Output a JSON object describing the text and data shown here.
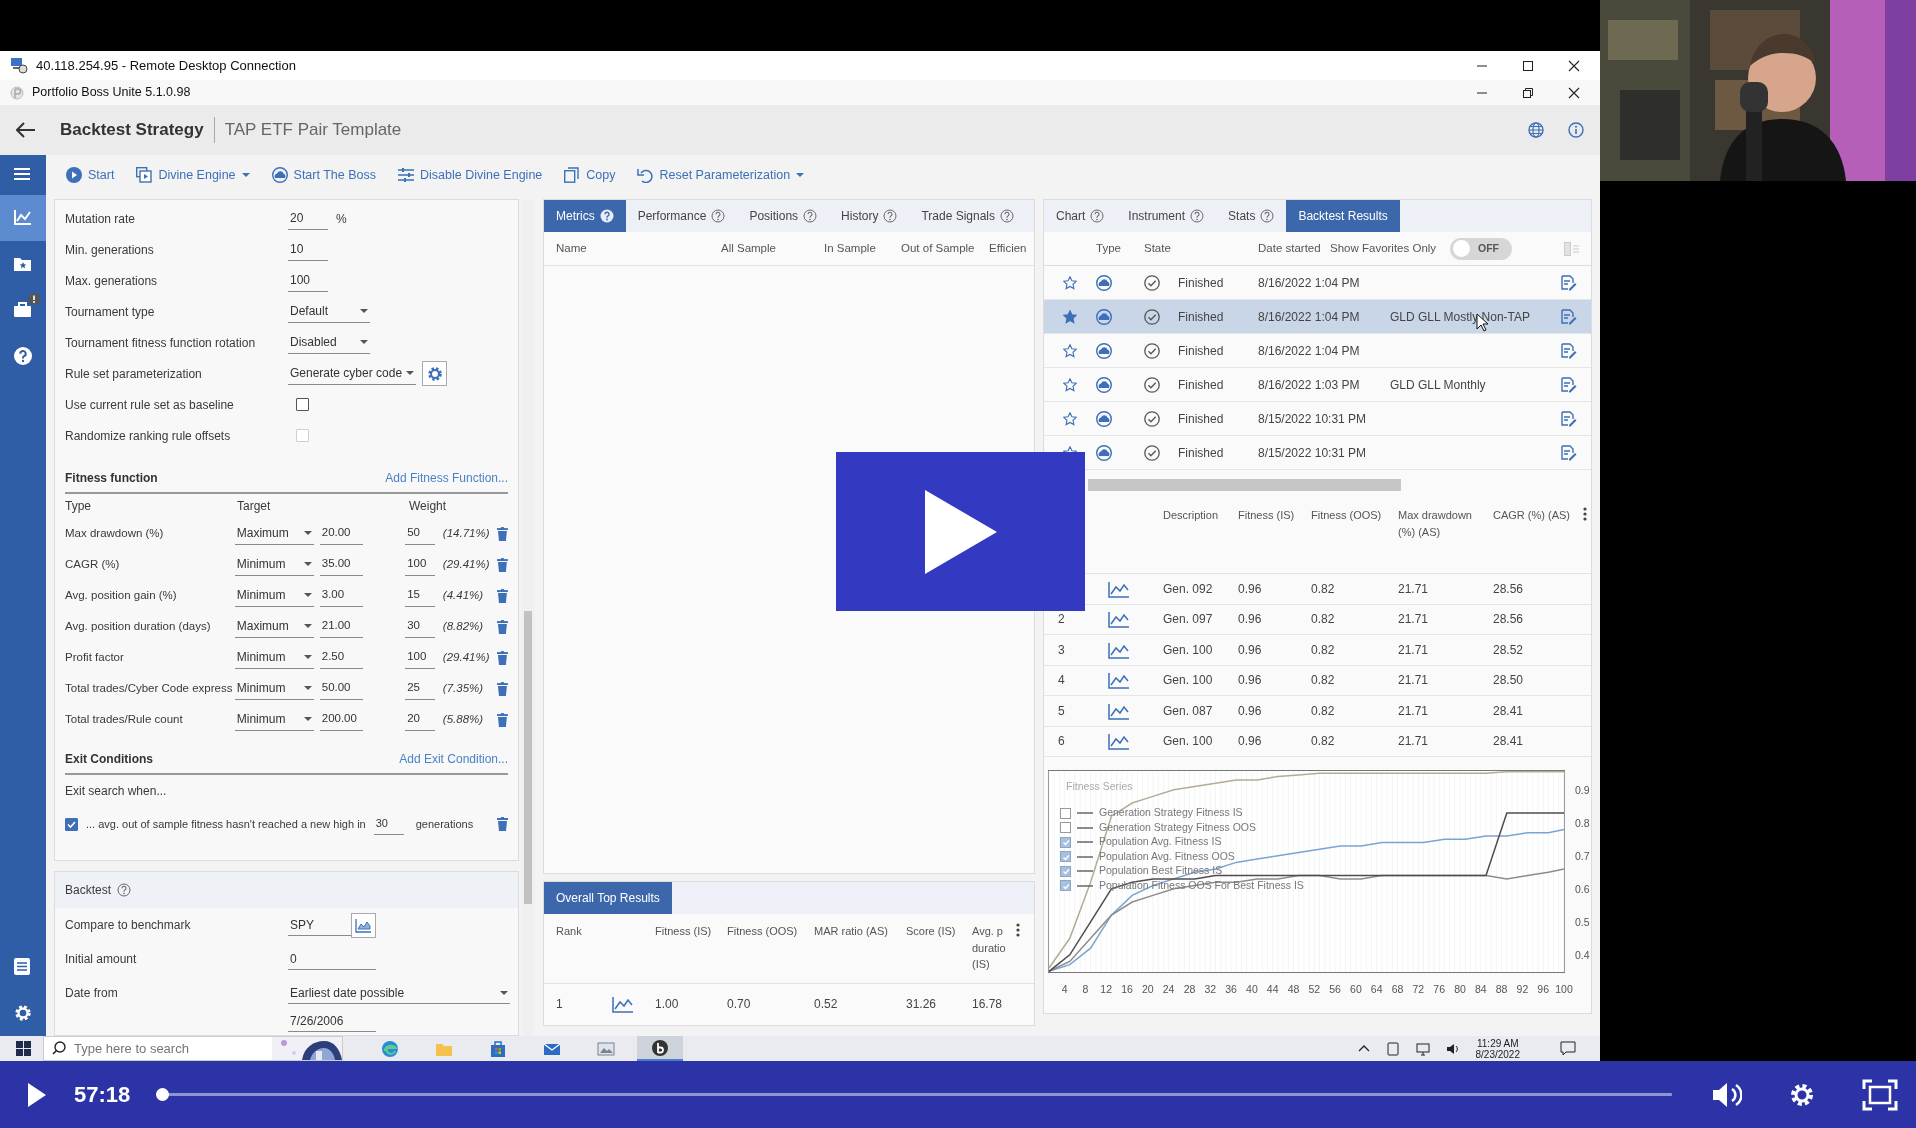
{
  "video": {
    "paused": true,
    "time": "57:18",
    "level": 0
  },
  "rdp_window": {
    "title": "40.118.254.95 - Remote Desktop Connection"
  },
  "app_window": {
    "title": "Portfolio Boss Unite 5.1.0.98"
  },
  "header": {
    "title": "Backtest Strategy",
    "subtitle": "TAP ETF Pair Template"
  },
  "sidebar": {
    "top": [
      {
        "kind": "menu",
        "selected": false,
        "alert": false
      },
      {
        "kind": "strategy",
        "selected": true,
        "alert": false
      },
      {
        "kind": "library",
        "selected": false,
        "alert": false
      },
      {
        "kind": "portfolio",
        "selected": false,
        "alert": true
      },
      {
        "kind": "help",
        "selected": false,
        "alert": false
      }
    ],
    "bottom": [
      {
        "kind": "log",
        "selected": false,
        "alert": false
      },
      {
        "kind": "settings",
        "selected": false,
        "alert": false
      }
    ]
  },
  "toolbar": [
    {
      "kind": "start",
      "label": "Start",
      "dropdown": false
    },
    {
      "kind": "engine",
      "label": "Divine Engine",
      "dropdown": true
    },
    {
      "kind": "boss",
      "label": "Start The Boss",
      "dropdown": false
    },
    {
      "kind": "sliders",
      "label": "Disable Divine Engine",
      "dropdown": false
    },
    {
      "kind": "copy",
      "label": "Copy",
      "dropdown": false
    },
    {
      "kind": "reset",
      "label": "Reset Parameterization",
      "dropdown": true
    }
  ],
  "settings": [
    {
      "kind": "number",
      "label": "Mutation rate",
      "value": "20",
      "unit": "%"
    },
    {
      "kind": "number",
      "label": "Min. generations",
      "value": "10"
    },
    {
      "kind": "number",
      "label": "Max. generations",
      "value": "100"
    },
    {
      "kind": "select",
      "label": "Tournament type",
      "value": "Default"
    },
    {
      "kind": "select",
      "label": "Tournament fitness function rotation",
      "value": "Disabled"
    },
    {
      "kind": "select_config",
      "label": "Rule set parameterization",
      "value": "Generate cyber code"
    },
    {
      "kind": "checkbox",
      "label": "Use current rule set as baseline",
      "checked": false,
      "disabled": false
    },
    {
      "kind": "checkbox",
      "label": "Randomize ranking rule offsets",
      "checked": false,
      "disabled": true
    }
  ],
  "fitness_function": {
    "title": "Fitness function",
    "add_link": "Add Fitness Function...",
    "columns": [
      "Type",
      "Target",
      "Weight"
    ],
    "rows": [
      {
        "type": "Max drawdown (%)",
        "target": "Maximum",
        "value": "20.00",
        "weight": "50",
        "share": "(14.71%)"
      },
      {
        "type": "CAGR (%)",
        "target": "Minimum",
        "value": "35.00",
        "weight": "100",
        "share": "(29.41%)"
      },
      {
        "type": "Avg. position gain (%)",
        "target": "Minimum",
        "value": "3.00",
        "weight": "15",
        "share": "(4.41%)"
      },
      {
        "type": "Avg. position duration (days)",
        "target": "Maximum",
        "value": "21.00",
        "weight": "30",
        "share": "(8.82%)"
      },
      {
        "type": "Profit factor",
        "target": "Minimum",
        "value": "2.50",
        "weight": "100",
        "share": "(29.41%)"
      },
      {
        "type": "Total trades/Cyber Code express",
        "target": "Minimum",
        "value": "50.00",
        "weight": "25",
        "share": "(7.35%)"
      },
      {
        "type": "Total trades/Rule count",
        "target": "Minimum",
        "value": "200.00",
        "weight": "20",
        "share": "(5.88%)"
      }
    ]
  },
  "exit_conditions": {
    "title": "Exit Conditions",
    "add_link": "Add Exit Condition...",
    "intro": "Exit search when...",
    "conditions": [
      {
        "checked": true,
        "text": "... avg. out of sample fitness hasn't reached a new high in",
        "value": "30",
        "unit": "generations"
      }
    ]
  },
  "backtest": {
    "title": "Backtest",
    "fields": [
      {
        "kind": "benchmark",
        "label": "Compare to benchmark",
        "value": "SPY"
      },
      {
        "kind": "number",
        "label": "Initial amount",
        "value": "0"
      },
      {
        "kind": "select",
        "label": "Date from",
        "value": "Earliest date possible"
      },
      {
        "kind": "date",
        "value": "7/26/2006"
      }
    ]
  },
  "metrics_tabs": [
    {
      "label": "Metrics",
      "selected": true,
      "help": true
    },
    {
      "label": "Performance",
      "selected": false,
      "help": true
    },
    {
      "label": "Positions",
      "selected": false,
      "help": true
    },
    {
      "label": "History",
      "selected": false,
      "help": true
    },
    {
      "label": "Trade Signals",
      "selected": false,
      "help": true
    }
  ],
  "metrics_table": {
    "columns": [
      "Name",
      "All Sample",
      "In Sample",
      "Out of Sample",
      "Efficien"
    ]
  },
  "top_results": {
    "title": "Overall Top Results",
    "columns": [
      "Rank",
      "Fitness (IS)",
      "Fitness (OOS)",
      "MAR ratio (AS)",
      "Score (IS)",
      "Avg. p duratio (IS)"
    ],
    "rows": [
      {
        "cells": [
          "1",
          "1.00",
          "0.70",
          "0.52",
          "31.26",
          "16.78"
        ]
      }
    ]
  },
  "result_tabs": [
    {
      "label": "Chart",
      "selected": false,
      "help": true
    },
    {
      "label": "Instrument",
      "selected": false,
      "help": true
    },
    {
      "label": "Stats",
      "selected": false,
      "help": true
    },
    {
      "label": "Backtest Results",
      "selected": true,
      "help": false
    }
  ],
  "backtests": {
    "columns": [
      "Type",
      "State",
      "Date started"
    ],
    "favorites_label": "Show Favorites Only",
    "favorites_toggle": {
      "on": false,
      "label": "OFF"
    },
    "rows": [
      {
        "favorite": false,
        "selected": false,
        "hovered": false,
        "state": "Finished",
        "date": "8/16/2022 1:04 PM"
      },
      {
        "favorite": true,
        "selected": true,
        "hovered": true,
        "state": "Finished",
        "date": "8/16/2022 1:04 PM",
        "description": "GLD GLL Mostly Non-TAP"
      },
      {
        "favorite": false,
        "selected": false,
        "hovered": false,
        "state": "Finished",
        "date": "8/16/2022 1:04 PM"
      },
      {
        "favorite": false,
        "selected": false,
        "hovered": false,
        "state": "Finished",
        "date": "8/16/2022 1:03 PM",
        "description": "GLD GLL Monthly"
      },
      {
        "favorite": false,
        "selected": false,
        "hovered": false,
        "state": "Finished",
        "date": "8/15/2022 10:31 PM"
      },
      {
        "favorite": false,
        "selected": false,
        "hovered": false,
        "state": "Finished",
        "date": "8/15/2022 10:31 PM"
      }
    ]
  },
  "generations": {
    "columns": [
      "Description",
      "Fitness (IS)",
      "Fitness (OOS)",
      "Max drawdown (%) (AS)",
      "CAGR (%) (AS)"
    ],
    "rows": [
      {
        "cells": [
          "Gen. 092",
          "0.96",
          "0.82",
          "21.71",
          "28.56"
        ]
      },
      {
        "rank": "2",
        "cells": [
          "Gen. 097",
          "0.96",
          "0.82",
          "21.71",
          "28.56"
        ]
      },
      {
        "rank": "3",
        "cells": [
          "Gen. 100",
          "0.96",
          "0.82",
          "21.71",
          "28.52"
        ]
      },
      {
        "rank": "4",
        "cells": [
          "Gen. 100",
          "0.96",
          "0.82",
          "21.71",
          "28.50"
        ]
      },
      {
        "rank": "5",
        "cells": [
          "Gen. 087",
          "0.96",
          "0.82",
          "21.71",
          "28.41"
        ]
      },
      {
        "rank": "6",
        "cells": [
          "Gen. 100",
          "0.96",
          "0.82",
          "21.71",
          "28.41"
        ]
      }
    ]
  },
  "fitness_chart": {
    "legend": [
      {
        "label": "Generation Strategy Fitness IS",
        "checked": false
      },
      {
        "label": "Generation Strategy Fitness OOS",
        "checked": false
      },
      {
        "label": "Population Avg. Fitness IS",
        "checked": true
      },
      {
        "label": "Population Avg. Fitness OOS",
        "checked": true
      },
      {
        "label": "Population Best Fitness IS",
        "checked": true
      },
      {
        "label": "Population Fitness OOS For Best Fitness IS",
        "checked": true
      }
    ],
    "chart_data": {
      "type": "line",
      "title": "Fitness Series",
      "x": [
        1,
        5,
        9,
        13,
        17,
        21,
        25,
        29,
        33,
        37,
        41,
        45,
        49,
        53,
        57,
        61,
        65,
        69,
        73,
        77,
        81,
        85,
        89,
        93,
        97,
        100
      ],
      "xlim": [
        1,
        100
      ],
      "ylim": [
        0.345,
        0.96
      ],
      "grid": true,
      "xticks": [
        4,
        8,
        12,
        16,
        20,
        24,
        28,
        32,
        36,
        40,
        44,
        48,
        52,
        56,
        60,
        64,
        68,
        72,
        76,
        80,
        84,
        88,
        92,
        96,
        100
      ],
      "yticks": [
        0.4,
        0.5,
        0.6,
        0.7,
        0.8,
        0.9
      ],
      "series": [
        {
          "color": "#7ba3d3",
          "values": [
            0.35,
            0.37,
            0.42,
            0.52,
            0.58,
            0.61,
            0.63,
            0.65,
            0.66,
            0.68,
            0.69,
            0.7,
            0.71,
            0.72,
            0.73,
            0.73,
            0.74,
            0.74,
            0.74,
            0.75,
            0.75,
            0.76,
            0.76,
            0.77,
            0.77,
            0.78
          ]
        },
        {
          "color": "#8c8c8c",
          "values": [
            0.35,
            0.38,
            0.45,
            0.52,
            0.56,
            0.58,
            0.6,
            0.61,
            0.62,
            0.62,
            0.63,
            0.63,
            0.64,
            0.64,
            0.63,
            0.63,
            0.64,
            0.64,
            0.64,
            0.64,
            0.64,
            0.64,
            0.63,
            0.64,
            0.65,
            0.66
          ]
        },
        {
          "color": "#b5ab95",
          "values": [
            0.36,
            0.45,
            0.62,
            0.82,
            0.86,
            0.88,
            0.9,
            0.91,
            0.92,
            0.93,
            0.93,
            0.94,
            0.945,
            0.95,
            0.95,
            0.95,
            0.95,
            0.95,
            0.95,
            0.95,
            0.95,
            0.95,
            0.955,
            0.955,
            0.955,
            0.955
          ]
        },
        {
          "color": "#4d4d4d",
          "values": [
            0.35,
            0.4,
            0.5,
            0.6,
            0.62,
            0.63,
            0.63,
            0.63,
            0.64,
            0.64,
            0.64,
            0.64,
            0.64,
            0.64,
            0.64,
            0.64,
            0.64,
            0.64,
            0.64,
            0.64,
            0.64,
            0.64,
            0.83,
            0.83,
            0.83,
            0.83
          ]
        }
      ]
    }
  },
  "taskbar": {
    "search_placeholder": "Type here to search",
    "apps": [
      {
        "kind": "edge",
        "active": false
      },
      {
        "kind": "folder",
        "active": false
      },
      {
        "kind": "store",
        "active": false
      },
      {
        "kind": "mail",
        "active": false
      },
      {
        "kind": "photos",
        "active": false
      },
      {
        "kind": "boss",
        "active": true
      }
    ],
    "time": "11:29 AM",
    "date": "8/23/2022"
  }
}
